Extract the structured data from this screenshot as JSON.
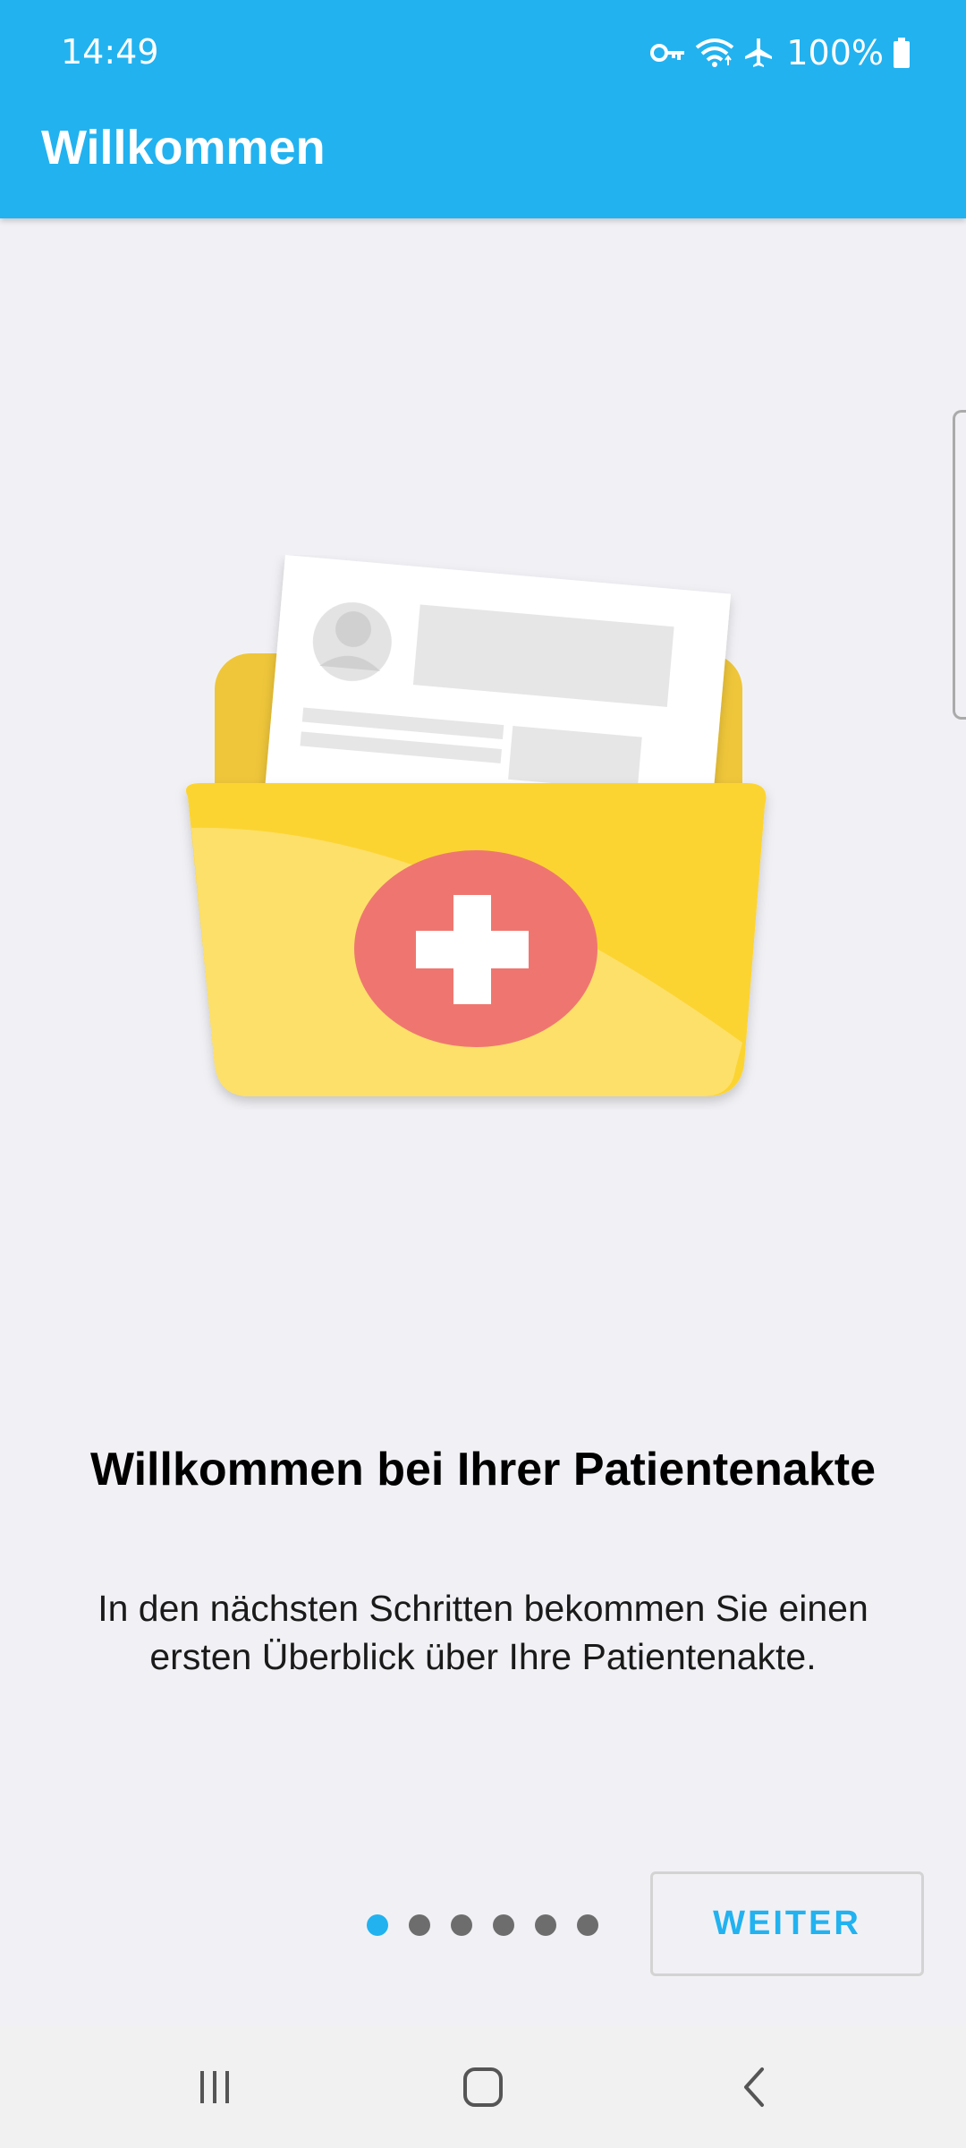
{
  "status": {
    "time": "14:49",
    "battery": "100%",
    "icons": [
      "vpn-key-icon",
      "wifi-icon",
      "airplane-icon",
      "battery-icon"
    ]
  },
  "appbar": {
    "title": "Willkommen"
  },
  "onboarding": {
    "headline": "Willkommen bei Ihrer Patientenakte",
    "body": "In den nächsten Schritten bekommen Sie einen ersten Überblick über Ihre Patientenakte.",
    "page_count": 6,
    "active_page": 1,
    "next_label": "WEITER"
  },
  "colors": {
    "accent": "#22b2f0",
    "folder": "#fcd431",
    "medical_badge": "#ef6e6a"
  },
  "navbar": {
    "icons": [
      "recent-apps-icon",
      "home-icon",
      "back-icon"
    ]
  }
}
